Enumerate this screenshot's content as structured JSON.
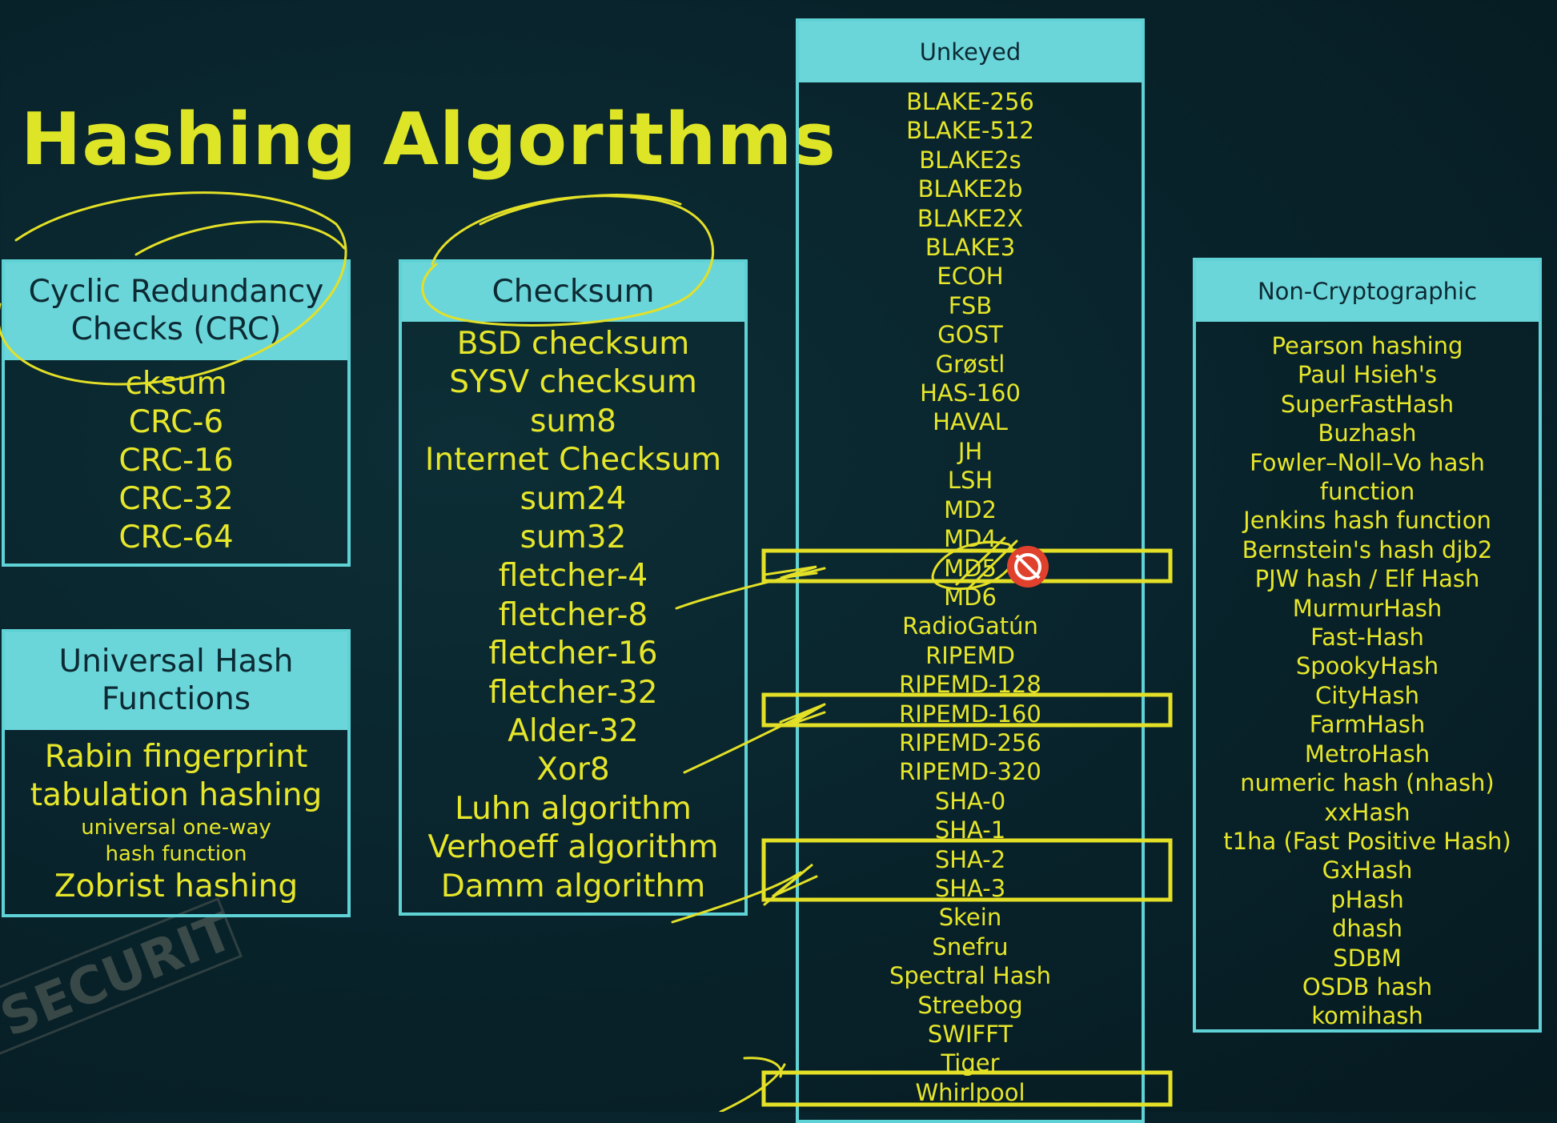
{
  "title": "Hashing Algorithms",
  "crc": {
    "header": "Cyclic Redundancy Checks (CRC)",
    "items": [
      "cksum",
      "CRC-6",
      "CRC-16",
      "CRC-32",
      "CRC-64"
    ]
  },
  "universal": {
    "header": "Universal Hash Functions",
    "items": [
      "Rabin fingerprint",
      "tabulation hashing",
      "universal one-way hash function",
      "Zobrist hashing"
    ]
  },
  "checksum": {
    "header": "Checksum",
    "items": [
      "BSD checksum",
      "SYSV checksum",
      "sum8",
      "Internet Checksum",
      "sum24",
      "sum32",
      "fletcher-4",
      "fletcher-8",
      "fletcher-16",
      "fletcher-32",
      "Alder-32",
      "Xor8",
      "Luhn algorithm",
      "Verhoeff algorithm",
      "Damm algorithm"
    ]
  },
  "unkeyed": {
    "header": "Unkeyed",
    "items": [
      "BLAKE-256",
      "BLAKE-512",
      "BLAKE2s",
      "BLAKE2b",
      "BLAKE2X",
      "BLAKE3",
      "ECOH",
      "FSB",
      "GOST",
      "Grøstl",
      "HAS-160",
      "HAVAL",
      "JH",
      "LSH",
      "MD2",
      "MD4",
      "MD5",
      "MD6",
      "RadioGatún",
      "RIPEMD",
      "RIPEMD-128",
      "RIPEMD-160",
      "RIPEMD-256",
      "RIPEMD-320",
      "SHA-0",
      "SHA-1",
      "SHA-2",
      "SHA-3",
      "Skein",
      "Snefru",
      "Spectral Hash",
      "Streebog",
      "SWIFFT",
      "Tiger",
      "Whirlpool"
    ]
  },
  "noncrypto": {
    "header": "Non-Cryptographic",
    "items": [
      "Pearson hashing",
      "Paul Hsieh's",
      "SuperFastHash",
      "Buzhash",
      "Fowler–Noll–Vo hash",
      "function",
      "Jenkins hash function",
      "Bernstein's hash djb2",
      "PJW hash / Elf Hash",
      "MurmurHash",
      "Fast-Hash",
      "SpookyHash",
      "CityHash",
      "FarmHash",
      "MetroHash",
      "numeric hash (nhash)",
      "xxHash",
      "t1ha (Fast Positive Hash)",
      "GxHash",
      "pHash",
      "dhash",
      "SDBM",
      "OSDB hash",
      "komihash"
    ]
  },
  "stamp_text": "SECURITY",
  "colors": {
    "background": "#08222a",
    "panel_border": "#5fd2d6",
    "panel_header": "#6bd6da",
    "item_text": "#e6e62a",
    "title": "#dde526",
    "annotation": "#e3e027",
    "deprecated_mark": "#e0412c"
  },
  "icons": [
    "no-entry-icon"
  ]
}
